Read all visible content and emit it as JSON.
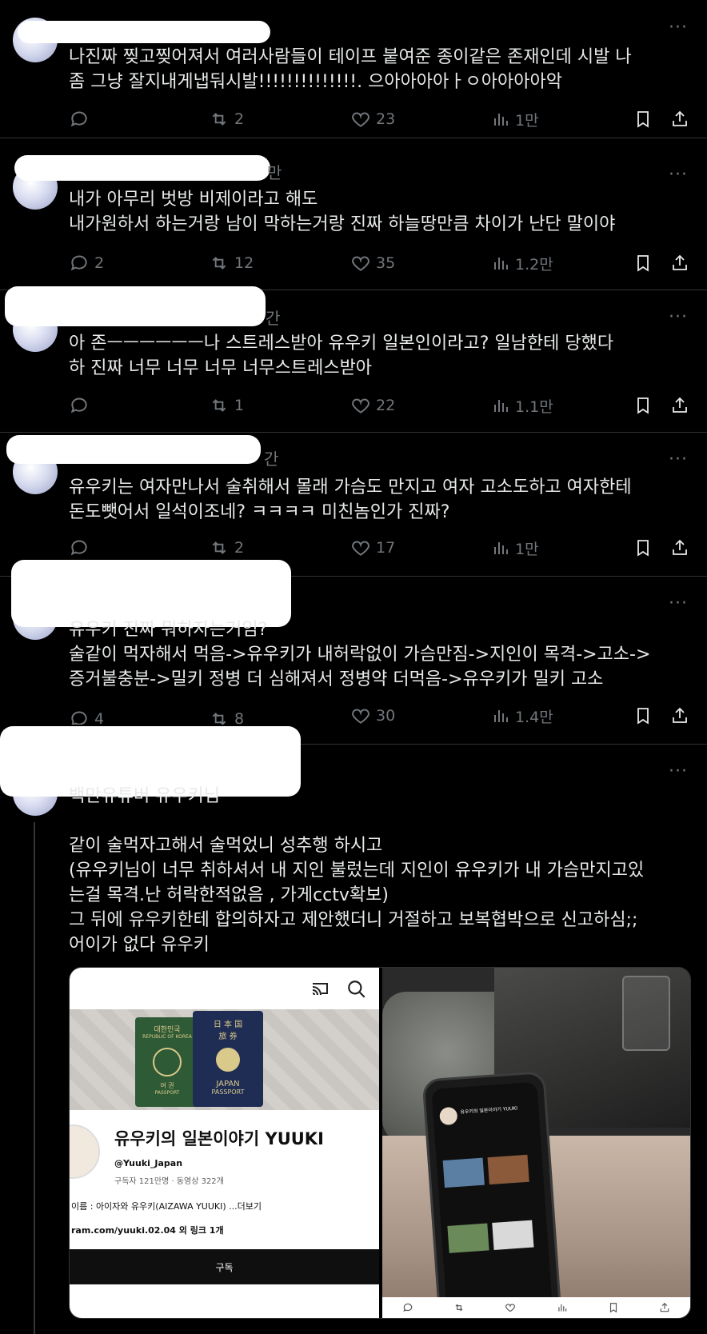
{
  "posts": [
    {
      "text": "나진짜 찢고찢어져서 여러사람들이 테이프 붙여준 종이같은 존재인데 시발 나\n좀 그냥 잘지내게냅둬시발!!!!!!!!!!!!!!. 으아아아아ㅏㅇ아아아아악",
      "ghost": "",
      "replies": "",
      "reposts": "2",
      "likes": "23",
      "views": "1만"
    },
    {
      "text": "내가 아무리 벗방 비제이라고 해도\n내가원하서 하는거랑 남이 막하는거랑 진짜 하늘땅만큼 차이가 난단 말이야",
      "ghost": "만",
      "replies": "2",
      "reposts": "12",
      "likes": "35",
      "views": "1.2만"
    },
    {
      "text": "아 존ㅡㅡㅡㅡㅡㅡ나 스트레스받아 유우키 일본인이라고? 일남한테 당했다\n하 진짜 너무 너무 너무 너무스트레스받아",
      "ghost": "간",
      "replies": "",
      "reposts": "1",
      "likes": "22",
      "views": "1.1만"
    },
    {
      "text": "유우키는 여자만나서 술취해서 몰래 가슴도 만지고 여자 고소도하고 여자한테\n돈도뺏어서 일석이조네? ㅋㅋㅋㅋ 미친놈인가 진짜?",
      "ghost": "간",
      "replies": "",
      "reposts": "2",
      "likes": "17",
      "views": "1만"
    },
    {
      "text": "유우키 진짜 뭐하자는거임?\n술같이 먹자해서 먹음->유우키가 내허락없이 가슴만짐->지인이 목격->고소->\n증거불충분->밀키 정병 더 심해져서 정병약 더먹음->유우키가 밀키 고소",
      "ghost": "",
      "replies": "4",
      "reposts": "8",
      "likes": "30",
      "views": "1.4만"
    },
    {
      "text": "백만유튜버 유우키님\n\n같이 술먹자고해서 술먹었니 성추행 하시고\n(유우키님이 너무 취하셔서 내 지인 불렀는데 지인이 유우키가 내 가슴만지고있\n는걸 목격.난 허락한적없음 , 가게cctv확보)\n그 뒤에 유우키한테 합의하자고 제안했더니 거절하고 보복협박으로 신고하심;;\n어이가 없다 유우키",
      "ghost": "",
      "replies": "",
      "reposts": "",
      "likes": "",
      "views": ""
    }
  ],
  "more_label": "···",
  "media": {
    "left": {
      "channel_name": "유우키의 일본이야기 YUUKI",
      "handle": "@Yuuki_Japan",
      "stats": "구독자 121만명 · 동영상 322개",
      "desc": "이름 : 아이자와 유우키(AIZAWA YUUKI) ...더보기",
      "link": "ram.com/yuuki.02.04 외 링크 1개",
      "subscribe": "구독",
      "passport_kr_top": "대한민국",
      "passport_kr_sub": "REPUBLIC OF KOREA",
      "passport_kr_label": "여 권",
      "passport_kr_label2": "PASSPORT",
      "passport_jp_top": "日 本 国",
      "passport_jp_sub": "旅 券",
      "passport_jp_label": "JAPAN",
      "passport_jp_label2": "PASSPORT"
    },
    "right": {
      "phone_title": "유우키의 일본이야기 YUUKI"
    }
  },
  "colors": {
    "background": "#000000",
    "text": "#e7e9ea",
    "muted": "#71767b",
    "divider": "#2f3336"
  }
}
